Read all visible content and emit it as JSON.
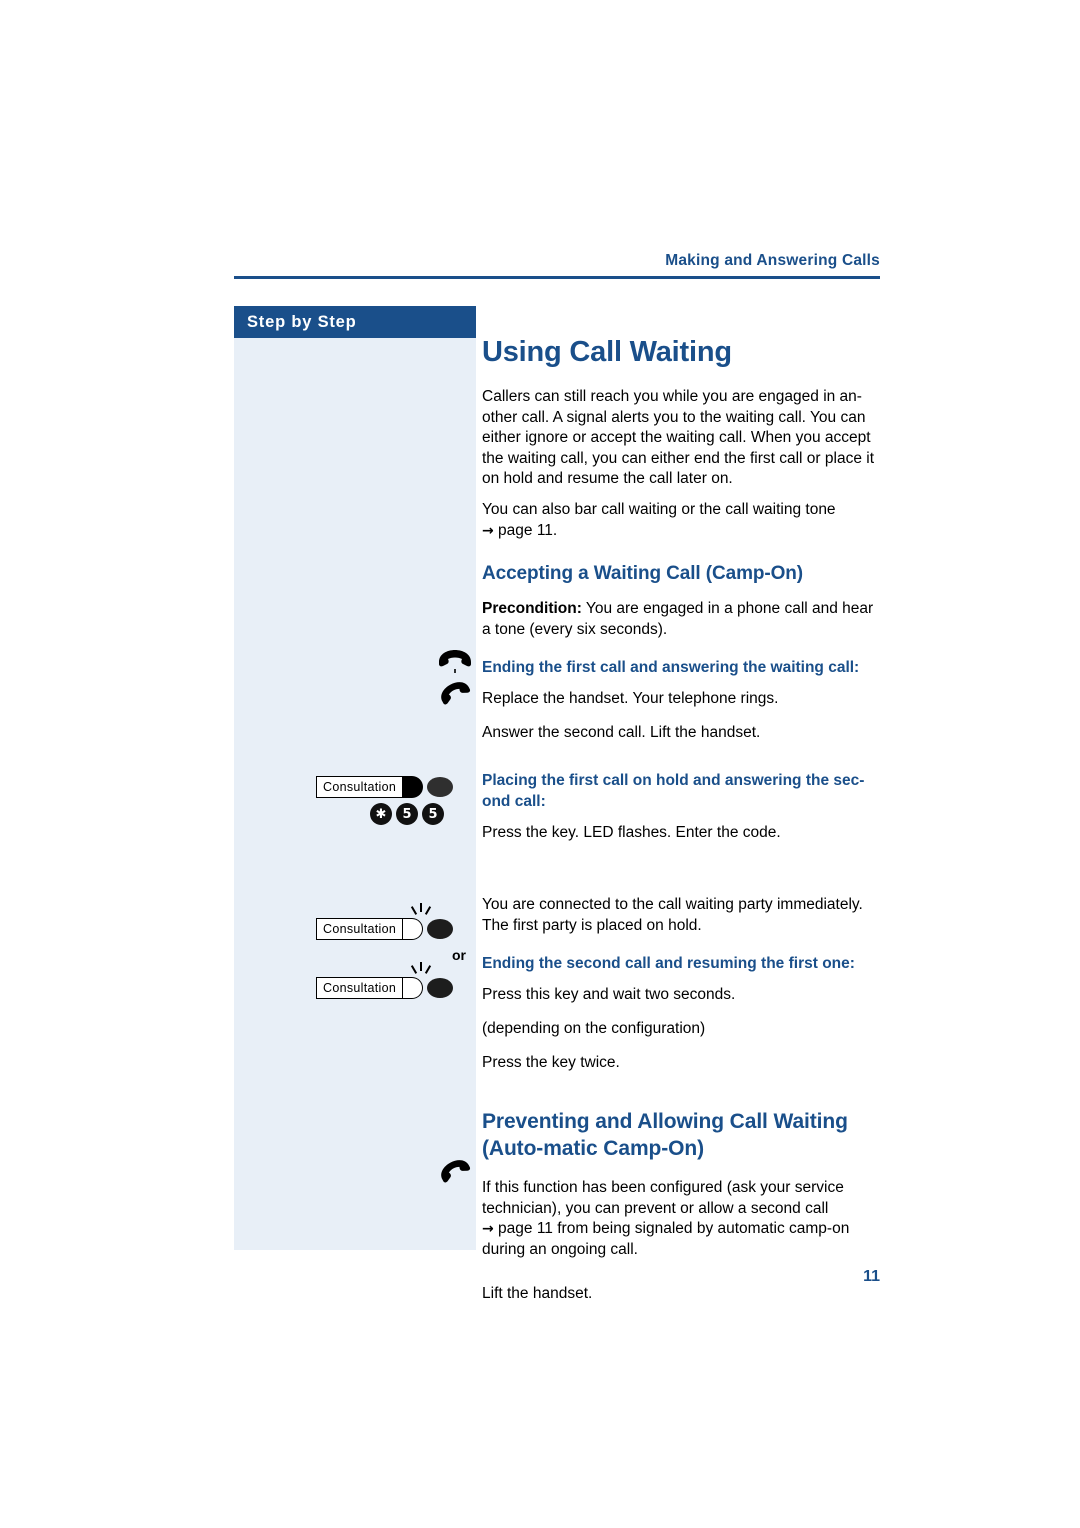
{
  "header": {
    "running_head": "Making and Answering Calls"
  },
  "sidebar": {
    "tab_label": "Step by Step"
  },
  "main": {
    "title": "Using Call Waiting",
    "intro_paragraph": "Callers can still reach you while you are engaged in an-other call. A signal alerts you to the waiting call. You can either ignore or accept the waiting call. When you accept the waiting call, you can either end the first call or place it on hold and resume the call later on.",
    "intro_paragraph_2": "You can also bar call waiting or the call waiting tone",
    "intro_page_ref": "page 11.",
    "arrow_glyph": "→",
    "section_camp_on": {
      "heading": "Accepting a Waiting Call (Camp-On)",
      "precondition_label": "Precondition:",
      "precondition_text": " You are engaged in a phone call and hear a tone (every six seconds).",
      "block_1": {
        "heading": "Ending the first call and answering the waiting call:",
        "step_1_text": "Replace the handset. Your telephone rings.",
        "step_1_icon": "handset-onhook-icon",
        "step_2_text": "Answer the second call. Lift the handset.",
        "step_2_icon": "handset-offhook-icon"
      },
      "block_2": {
        "heading": "Placing the first call on hold and answering the sec-ond call:",
        "step_1_text": "Press the key. LED flashes. Enter the code.",
        "key_label": "Consultation",
        "digits": [
          "✱",
          "5",
          "5"
        ],
        "result_text": "You are connected to the call waiting party immediately. The first party is placed on hold."
      },
      "block_3": {
        "heading": "Ending the second call and resuming the first one:",
        "step_1_text": "Press this key and wait two seconds.",
        "key_label_1": "Consultation",
        "or_label": "or",
        "alt_note": "(depending on the configuration)",
        "step_2_text": "Press the key twice.",
        "key_label_2": "Consultation"
      }
    },
    "section_auto_camp_on": {
      "heading": "Preventing and Allowing Call Waiting (Auto-matic Camp-On)",
      "paragraph_a": "If this function has been configured (ask your service technician), you can prevent or allow a second call",
      "page_ref": "page 11",
      "paragraph_b": " from being signaled by automatic camp-on during an ongoing call.",
      "step_text": "Lift the handset.",
      "step_icon": "handset-offhook-icon"
    }
  },
  "footer": {
    "page_number": "11"
  },
  "colors": {
    "accent": "#1a4f8a",
    "sidebar_bg": "#e8eff7"
  }
}
